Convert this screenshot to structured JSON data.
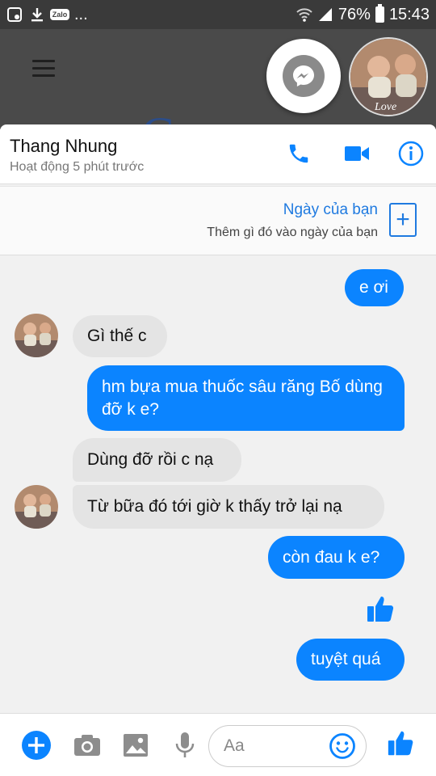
{
  "status_bar": {
    "notifications": [
      "gallery-icon",
      "download-icon",
      "zalo-icon",
      "more-dots-icon"
    ],
    "zalo_label": "Zalo",
    "more_label": "...",
    "battery": "76%",
    "time": "15:43"
  },
  "chat": {
    "contact_name": "Thang Nhung",
    "active_status": "Hoạt động 5 phút trước",
    "accent_color": "#0b84ff"
  },
  "day_banner": {
    "title": "Ngày của bạn",
    "subtitle": "Thêm gì đó vào ngày của bạn"
  },
  "messages": [
    {
      "from": "me",
      "text": "e ơi"
    },
    {
      "from": "them",
      "text": "Gì thế c"
    },
    {
      "from": "me",
      "text": "hm bựa mua thuốc sâu răng Bố dùng đỡ k e?"
    },
    {
      "from": "them",
      "text": "Dùng đỡ rồi c nạ"
    },
    {
      "from": "them",
      "text": "Từ bữa đó tới giờ k thấy trở lại nạ"
    },
    {
      "from": "me",
      "text": "còn đau k e?"
    },
    {
      "from": "me",
      "type": "like",
      "icon": "thumbs-up-icon"
    },
    {
      "from": "me",
      "text": "tuyệt quá"
    }
  ],
  "composer": {
    "placeholder": "Aa",
    "buttons": [
      "plus-icon",
      "camera-icon",
      "image-icon",
      "mic-icon",
      "emoji-icon",
      "thumbs-up-icon"
    ]
  }
}
